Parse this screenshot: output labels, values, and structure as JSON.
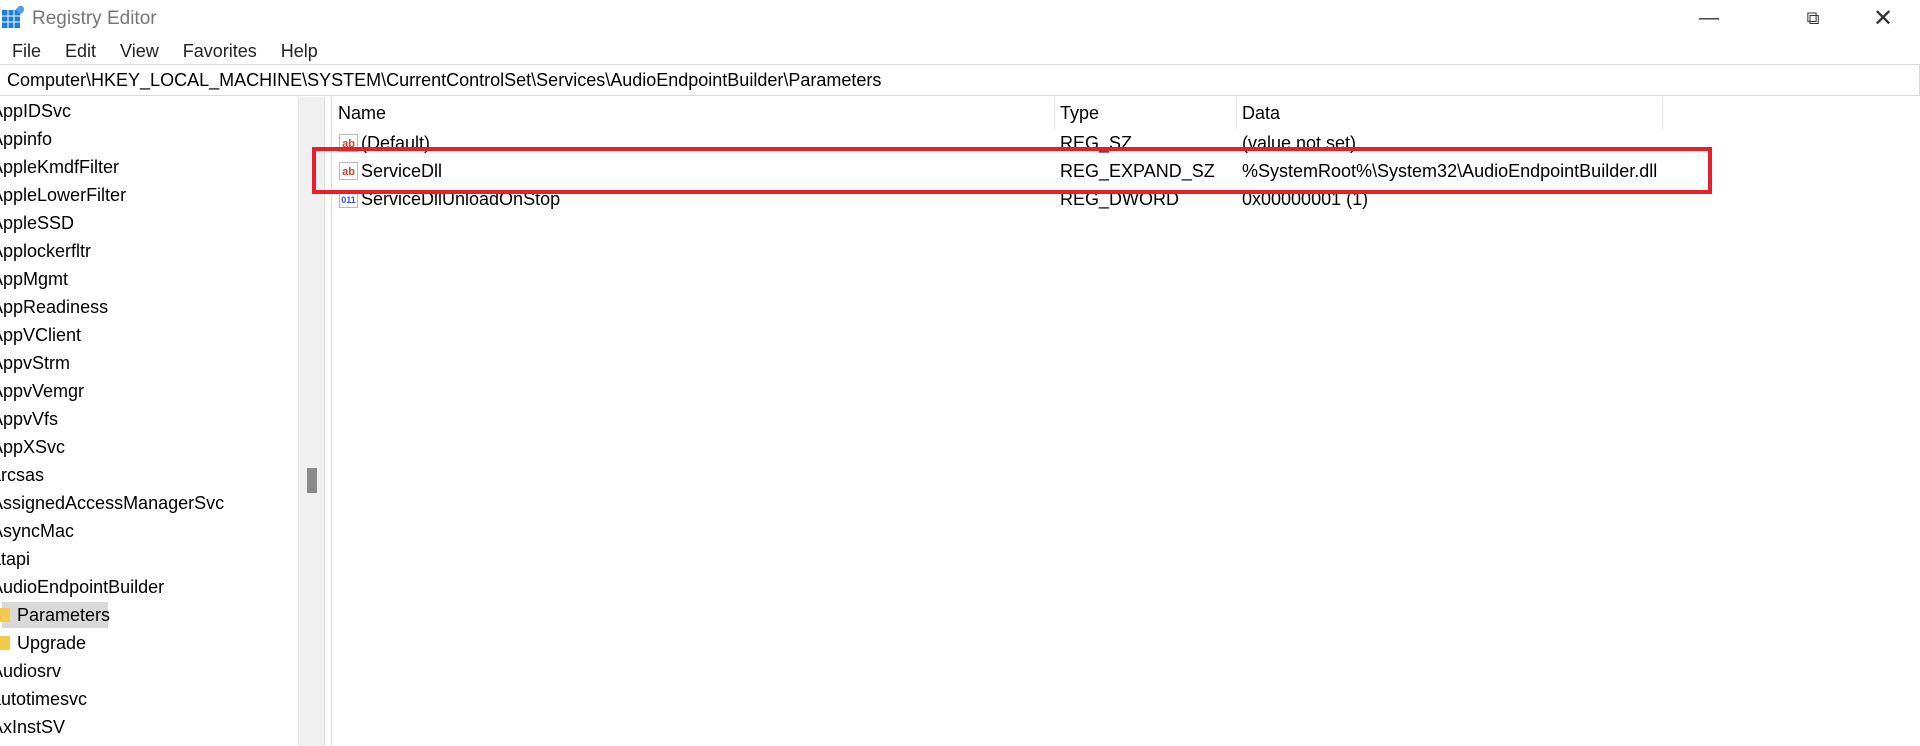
{
  "window": {
    "title": "Registry Editor",
    "controls": [
      "minimize",
      "maximize",
      "close"
    ]
  },
  "menu": [
    "File",
    "Edit",
    "View",
    "Favorites",
    "Help"
  ],
  "address": "Computer\\HKEY_LOCAL_MACHINE\\SYSTEM\\CurrentControlSet\\Services\\AudioEndpointBuilder\\Parameters",
  "tree": [
    {
      "label": "AppIDSvc"
    },
    {
      "label": "Appinfo"
    },
    {
      "label": "AppleKmdfFilter"
    },
    {
      "label": "AppleLowerFilter"
    },
    {
      "label": "AppleSSD"
    },
    {
      "label": "Applockerfltr"
    },
    {
      "label": "AppMgmt"
    },
    {
      "label": "AppReadiness"
    },
    {
      "label": "AppVClient"
    },
    {
      "label": "AppvStrm"
    },
    {
      "label": "AppvVemgr"
    },
    {
      "label": "AppvVfs"
    },
    {
      "label": "AppXSvc"
    },
    {
      "label": "arcsas"
    },
    {
      "label": "AssignedAccessManagerSvc"
    },
    {
      "label": "AsyncMac"
    },
    {
      "label": "atapi"
    },
    {
      "label": "AudioEndpointBuilder"
    },
    {
      "label": "Parameters",
      "child": true,
      "selected": true
    },
    {
      "label": "Upgrade",
      "child": true
    },
    {
      "label": "Audiosrv"
    },
    {
      "label": "autotimesvc"
    },
    {
      "label": "AxInstSV"
    }
  ],
  "columns": {
    "name": "Name",
    "type": "Type",
    "data": "Data"
  },
  "values": [
    {
      "name": "(Default)",
      "type": "REG_SZ",
      "data": "(value not set)",
      "icon": "string-value-icon"
    },
    {
      "name": "ServiceDll",
      "type": "REG_EXPAND_SZ",
      "data": "%SystemRoot%\\System32\\AudioEndpointBuilder.dll",
      "icon": "string-value-icon"
    },
    {
      "name": "ServiceDllUnloadOnStop",
      "type": "REG_DWORD",
      "data": "0x00000001 (1)",
      "icon": "binary-value-icon"
    }
  ],
  "highlight_color": "#e5202a"
}
